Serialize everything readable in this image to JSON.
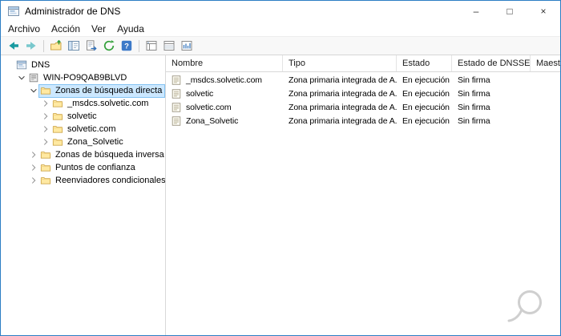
{
  "window": {
    "title": "Administrador de DNS",
    "controls": {
      "minimize": "–",
      "maximize": "□",
      "close": "×"
    }
  },
  "menu": {
    "items": [
      "Archivo",
      "Acción",
      "Ver",
      "Ayuda"
    ]
  },
  "toolbar": {
    "groups": [
      [
        "back",
        "forward"
      ],
      [
        "up-level",
        "show-hide-console-tree",
        "export-list",
        "refresh",
        "help"
      ],
      [
        "list-view",
        "details-view",
        "report-view"
      ]
    ]
  },
  "tree": {
    "items": [
      {
        "label": "DNS",
        "level": 0,
        "icon": "dns-root",
        "chevron": "none",
        "selected": false
      },
      {
        "label": "WIN-PO9QAB9BLVD",
        "level": 1,
        "icon": "server",
        "chevron": "expanded",
        "selected": false
      },
      {
        "label": "Zonas de búsqueda directa",
        "level": 2,
        "icon": "folder",
        "chevron": "expanded",
        "selected": true
      },
      {
        "label": "_msdcs.solvetic.com",
        "level": 3,
        "icon": "folder",
        "chevron": "collapsed",
        "selected": false
      },
      {
        "label": "solvetic",
        "level": 3,
        "icon": "folder",
        "chevron": "collapsed",
        "selected": false
      },
      {
        "label": "solvetic.com",
        "level": 3,
        "icon": "folder",
        "chevron": "collapsed",
        "selected": false
      },
      {
        "label": "Zona_Solvetic",
        "level": 3,
        "icon": "folder",
        "chevron": "collapsed",
        "selected": false
      },
      {
        "label": "Zonas de búsqueda inversa",
        "level": 2,
        "icon": "folder",
        "chevron": "collapsed",
        "selected": false
      },
      {
        "label": "Puntos de confianza",
        "level": 2,
        "icon": "folder",
        "chevron": "collapsed",
        "selected": false
      },
      {
        "label": "Reenviadores condicionales",
        "level": 2,
        "icon": "folder",
        "chevron": "collapsed",
        "selected": false
      }
    ]
  },
  "list": {
    "columns": [
      {
        "label": "Nombre",
        "width": 146
      },
      {
        "label": "Tipo",
        "width": 142
      },
      {
        "label": "Estado",
        "width": 69
      },
      {
        "label": "Estado de DNSSEC",
        "width": 98
      },
      {
        "label": "Maestr",
        "width": 80
      }
    ],
    "rows": [
      {
        "cells": [
          "_msdcs.solvetic.com",
          "Zona primaria integrada de A...",
          "En ejecución",
          "Sin firma",
          ""
        ]
      },
      {
        "cells": [
          "solvetic",
          "Zona primaria integrada de A...",
          "En ejecución",
          "Sin firma",
          ""
        ]
      },
      {
        "cells": [
          "solvetic.com",
          "Zona primaria integrada de A...",
          "En ejecución",
          "Sin firma",
          ""
        ]
      },
      {
        "cells": [
          "Zona_Solvetic",
          "Zona primaria integrada de A...",
          "En ejecución",
          "Sin firma",
          ""
        ]
      }
    ]
  },
  "watermark_icon": "solvetic-logo",
  "colors": {
    "accent_border": "#2d7ec4",
    "selection_bg": "#cce8ff",
    "selection_border": "#84c3f2",
    "toolbar_bg": "#f8f8f8",
    "arrow_teal": "#1a9ba1",
    "folder_fill": "#ffe9a2",
    "folder_stroke": "#cda64a"
  }
}
